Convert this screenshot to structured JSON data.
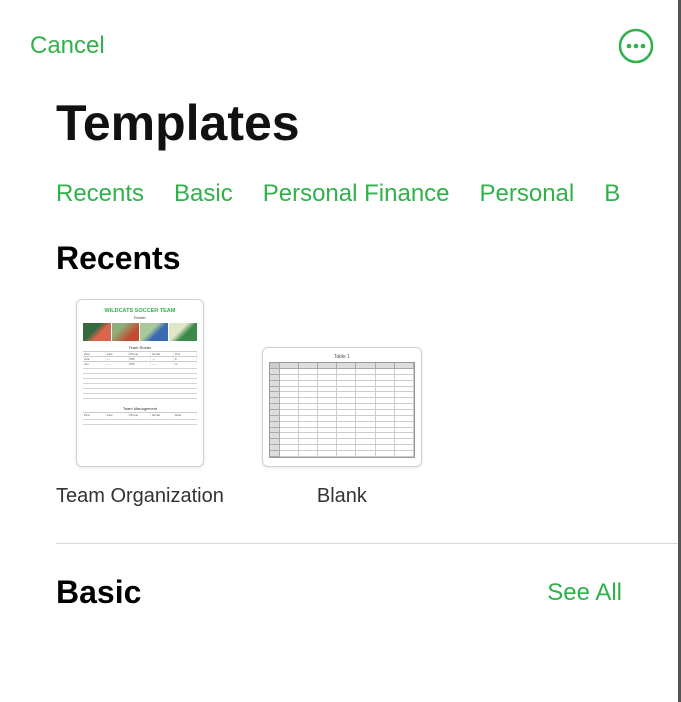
{
  "topbar": {
    "cancel": "Cancel"
  },
  "title": "Templates",
  "tabs": [
    "Recents",
    "Basic",
    "Personal Finance",
    "Personal",
    "B"
  ],
  "recents": {
    "heading": "Recents",
    "items": [
      {
        "label": "Team Organization",
        "thumb_title": "WILDCATS SOCCER TEAM",
        "thumb_subtitle": "Roster"
      },
      {
        "label": "Blank",
        "thumb_sheet": "Table 1"
      }
    ]
  },
  "basic": {
    "heading": "Basic",
    "see_all": "See All"
  }
}
